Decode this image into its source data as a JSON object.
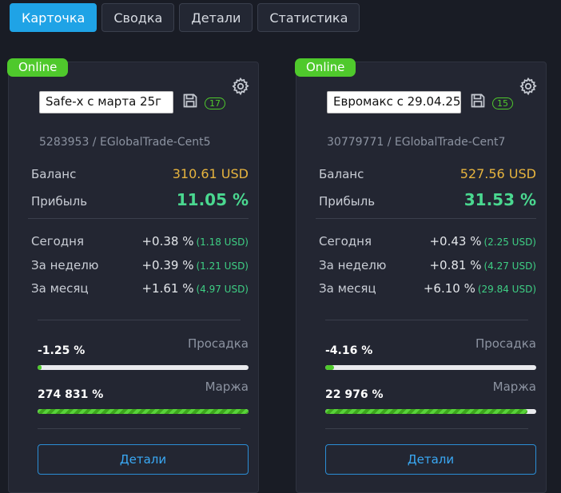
{
  "tabs": [
    {
      "label": "Карточка",
      "active": true
    },
    {
      "label": "Сводка"
    },
    {
      "label": "Детали"
    },
    {
      "label": "Статистика"
    }
  ],
  "accounts": [
    {
      "status": "Online",
      "name": "Safe-x с марта 25г",
      "count": "17",
      "account": "5283953 / EGlobalTrade-Cent5",
      "balance_label": "Баланс",
      "balance": "310.61 USD",
      "profit_label": "Прибыль",
      "profit": "11.05 %",
      "today_label": "Сегодня",
      "today_pct": "+0.38 %",
      "today_usd": "(1.18 USD)",
      "week_label": "За неделю",
      "week_pct": "+0.39 %",
      "week_usd": "(1.21 USD)",
      "month_label": "За месяц",
      "month_pct": "+1.61 %",
      "month_usd": "(4.97 USD)",
      "drawdown_value": "-1.25 %",
      "drawdown_label": "Просадка",
      "drawdown_fill": 0.0125,
      "margin_value": "274 831 %",
      "margin_label": "Маржа",
      "margin_fill": 1.0,
      "details_label": "Детали"
    },
    {
      "status": "Online",
      "name": "Евромакс с 29.04.25",
      "count": "15",
      "account": "30779771 / EGlobalTrade-Cent7",
      "balance_label": "Баланс",
      "balance": "527.56 USD",
      "profit_label": "Прибыль",
      "profit": "31.53 %",
      "today_label": "Сегодня",
      "today_pct": "+0.43 %",
      "today_usd": "(2.25 USD)",
      "week_label": "За неделю",
      "week_pct": "+0.81 %",
      "week_usd": "(4.27 USD)",
      "month_label": "За месяц",
      "month_pct": "+6.10 %",
      "month_usd": "(29.84 USD)",
      "drawdown_value": "-4.16 %",
      "drawdown_label": "Просадка",
      "drawdown_fill": 0.0416,
      "margin_value": "22 976 %",
      "margin_label": "Маржа",
      "margin_fill": 0.96,
      "details_label": "Детали"
    }
  ],
  "icons": {
    "settings": "gear-icon",
    "save": "save-icon"
  },
  "colors": {
    "accent": "#1fa3e6",
    "online": "#4fc92c",
    "balance": "#e7b43e",
    "profit": "#4ad890"
  }
}
